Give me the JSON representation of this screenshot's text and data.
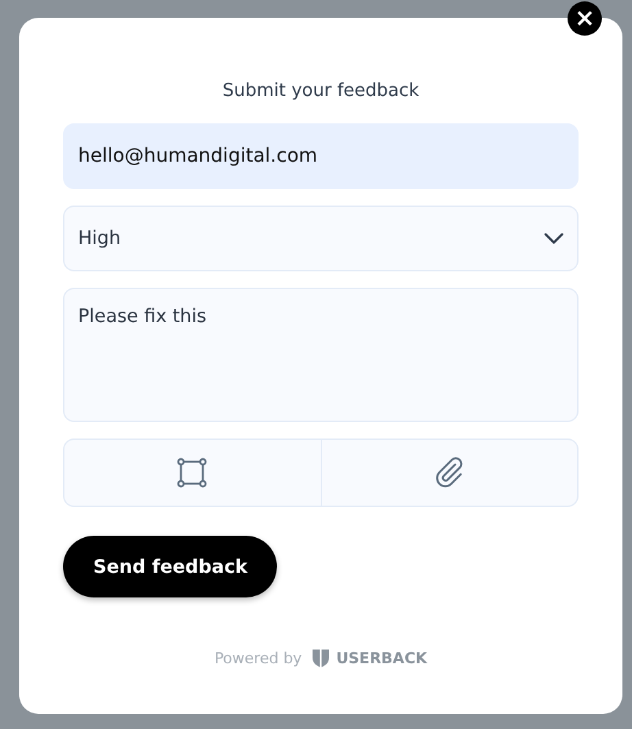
{
  "close_button": {
    "label": "×"
  },
  "dialog": {
    "title": "Submit your feedback",
    "email_field": {
      "value": "hello@humandigital.com"
    },
    "priority_select": {
      "value": "High"
    },
    "message_field": {
      "value": "Please fix this"
    },
    "submit_button": {
      "label": "Send feedback"
    },
    "footer": {
      "powered_by": "Powered by",
      "brand": "USERBACK"
    }
  }
}
